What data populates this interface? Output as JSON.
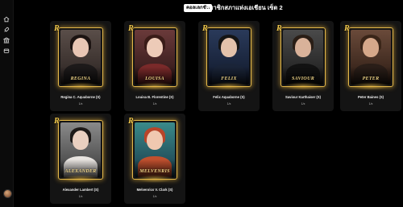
{
  "header": {
    "pill_label": "คอลเลกชัน",
    "title": "สมาชิกสภาแห่งเอเชียน เซ็ต 2"
  },
  "sidebar": {
    "icons": [
      "home-icon",
      "rocket-icon",
      "bank-icon",
      "cards-icon"
    ]
  },
  "logo_text": "R",
  "colors": {
    "accent": "#e5b94a",
    "card_bg": "#141414",
    "page_bg": "#000000"
  },
  "cards": [
    {
      "nameplate": "REGINA",
      "name": "Regina C. Aquaborne (S)",
      "count": "1/x"
    },
    {
      "nameplate": "LOUISA",
      "name": "Louisa B. Florentine (S)",
      "count": "1/x"
    },
    {
      "nameplate": "FELIX",
      "name": "Felix Aquaborne (S)",
      "count": "1/x"
    },
    {
      "nameplate": "SAVIOUR",
      "name": "Saviour Karthaiser (S)",
      "count": "1/x"
    },
    {
      "nameplate": "PETER",
      "name": "Peter Baines (S)",
      "count": "1/x"
    },
    {
      "nameplate": "ALEXANDER",
      "name": "Alexander Lambert (S)",
      "count": "1/x"
    },
    {
      "nameplate": "MELVENRIS",
      "name": "Melvenrics V. Clark (S)",
      "count": "1/x"
    }
  ]
}
